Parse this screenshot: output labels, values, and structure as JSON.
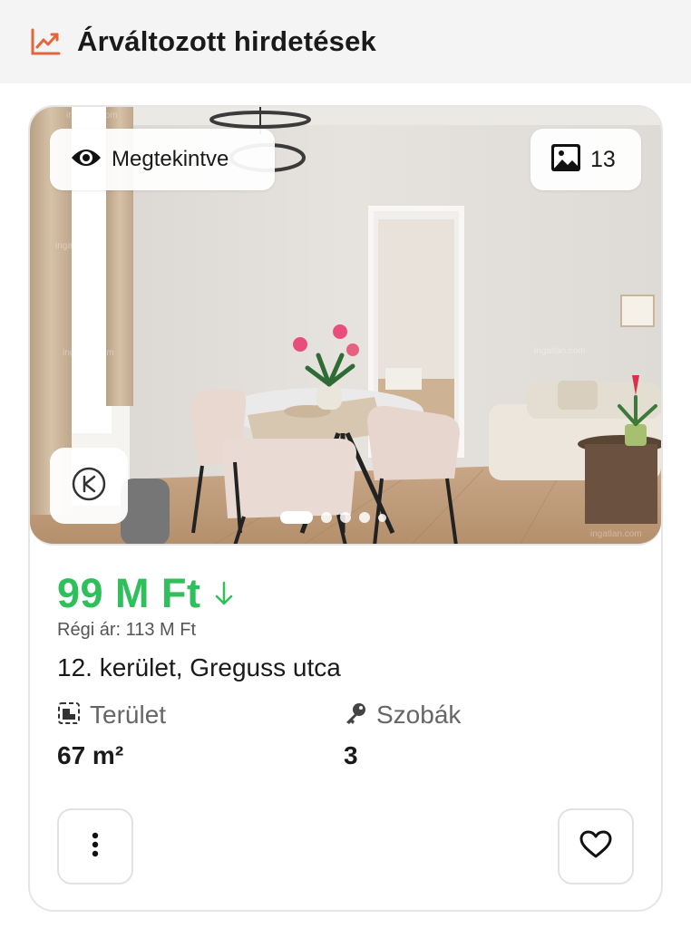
{
  "header": {
    "title": "Árváltozott hirdetések",
    "icon": "trend-chart-icon",
    "accent": "#e2663a"
  },
  "listing": {
    "viewed_label": "Megtekintve",
    "photo_count": "13",
    "carousel": {
      "total": 5,
      "active_index": 0
    },
    "price": "99 M Ft",
    "price_color": "#2fbf5b",
    "price_trend": "down",
    "old_price": "Régi ár: 113 M Ft",
    "address": "12. kerület, Greguss utca",
    "area_label": "Terület",
    "area_value": "67 m²",
    "rooms_label": "Szobák",
    "rooms_value": "3",
    "watermark": "ingatlan.com"
  }
}
